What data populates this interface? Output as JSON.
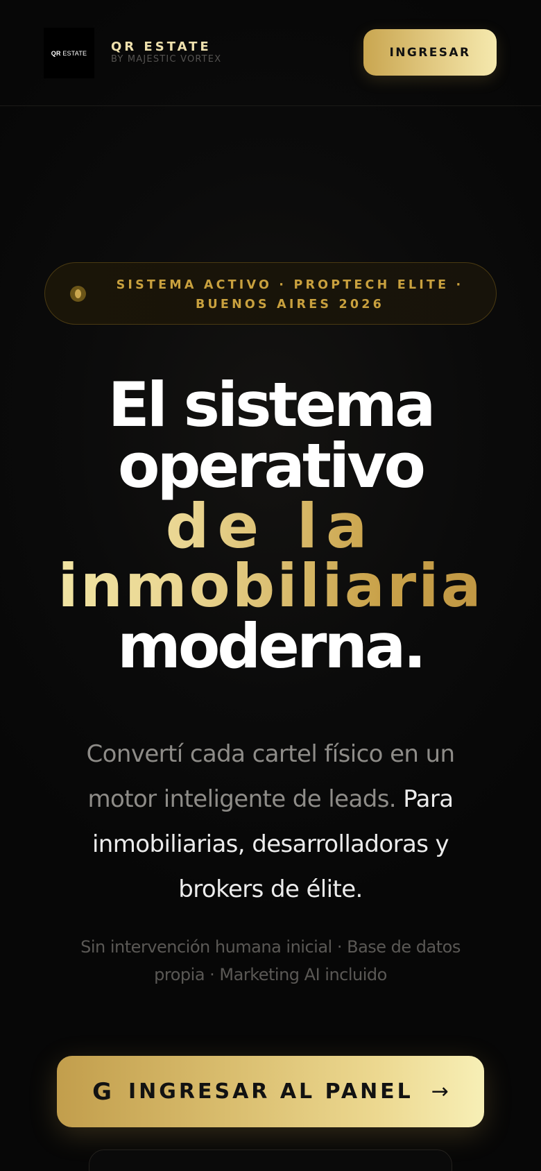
{
  "header": {
    "logo_text_bold": "QR",
    "logo_text_rest": " ESTATE",
    "brand_name": "QR ESTATE",
    "brand_sub": "BY MAJESTIC VORTEX",
    "login_label": "INGRESAR"
  },
  "status": {
    "text": "SISTEMA ACTIVO · PROPTECH ELITE · BUENOS AIRES 2026"
  },
  "headline": {
    "line1": "El sistema",
    "line2": "operativo",
    "line3_gold": "de la",
    "line4_gold": "inmobiliaria",
    "line5": "moderna."
  },
  "description": {
    "muted": "Convertí cada cartel físico en un motor inteligente de leads.",
    "highlight": "Para inmobiliarias, desarrolladoras y brokers de élite."
  },
  "subtext": "Sin intervención humana inicial · Base de datos propia · Marketing AI incluido",
  "cta": {
    "icon_glyph": "G",
    "label": "INGRESAR AL PANEL",
    "arrow_glyph": "→"
  },
  "colors": {
    "background": "#080808",
    "gold_light": "#f5e9ae",
    "gold_mid": "#d9bd6e",
    "gold_dark": "#c29e4c",
    "status_text": "#c9a13e"
  },
  "icons": {
    "cta_icon": "google-icon",
    "cta_arrow": "arrow-right-icon",
    "status_indicator": "status-dot-icon"
  }
}
